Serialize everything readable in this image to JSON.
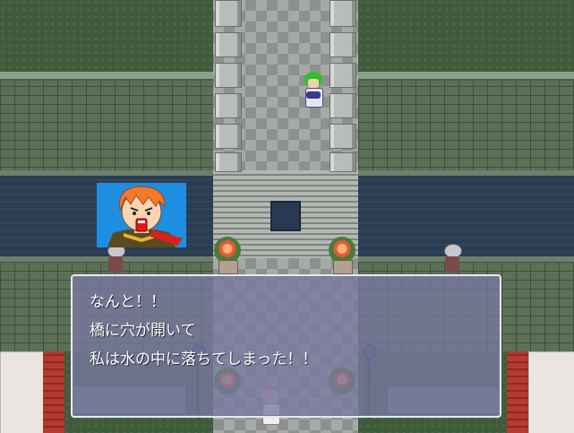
{
  "message": {
    "lines": [
      "なんと！！",
      "橋に穴が開いて",
      "私は水の中に落ちてしまった！！"
    ]
  },
  "colors": {
    "message_window_bg": "#7878a0",
    "message_text": "#ffffff",
    "portrait_bg": "#1e8ee0",
    "water": "#2b3d52"
  },
  "characters": {
    "hero": {
      "hair": "green"
    },
    "speaker_portrait": {
      "hair": "orange",
      "expression": "shouting"
    }
  }
}
